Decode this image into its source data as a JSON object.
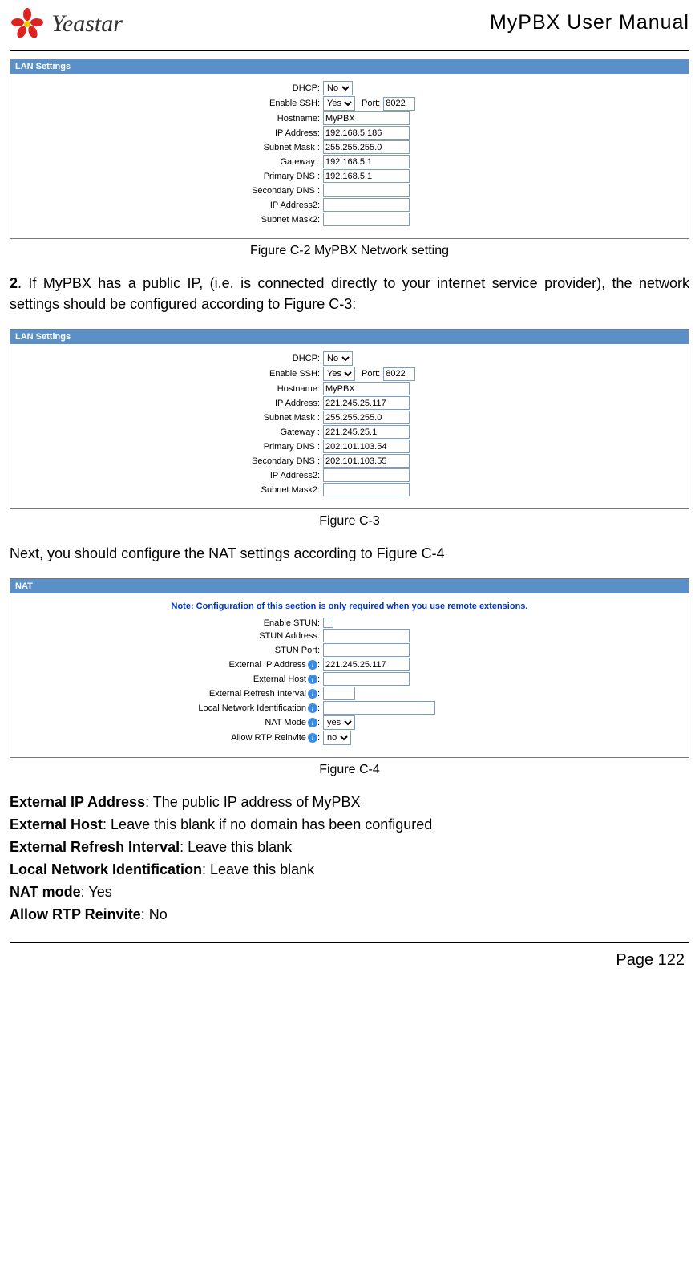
{
  "header": {
    "brand": "Yeastar",
    "doc_title": "MyPBX User Manual"
  },
  "figC2": {
    "panel_title": "LAN Settings",
    "caption": "Figure C-2 MyPBX Network setting",
    "fields": {
      "dhcp_label": "DHCP:",
      "dhcp_value": "No",
      "ssh_label": "Enable SSH:",
      "ssh_value": "Yes",
      "port_label": "Port:",
      "port_value": "8022",
      "hostname_label": "Hostname:",
      "hostname_value": "MyPBX",
      "ip_label": "IP Address:",
      "ip_value": "192.168.5.186",
      "mask_label": "Subnet Mask :",
      "mask_value": "255.255.255.0",
      "gw_label": "Gateway :",
      "gw_value": "192.168.5.1",
      "dns1_label": "Primary DNS :",
      "dns1_value": "192.168.5.1",
      "dns2_label": "Secondary DNS :",
      "dns2_value": "",
      "ip2_label": "IP Address2:",
      "ip2_value": "",
      "mask2_label": "Subnet Mask2:",
      "mask2_value": ""
    }
  },
  "para2_num": "2",
  "para2": ". If MyPBX has a public IP, (i.e. is connected directly to your internet service provider), the network settings should be configured according to Figure C-3:",
  "figC3": {
    "panel_title": "LAN Settings",
    "caption": "Figure C-3",
    "fields": {
      "dhcp_label": "DHCP:",
      "dhcp_value": "No",
      "ssh_label": "Enable SSH:",
      "ssh_value": "Yes",
      "port_label": "Port:",
      "port_value": "8022",
      "hostname_label": "Hostname:",
      "hostname_value": "MyPBX",
      "ip_label": "IP Address:",
      "ip_value": "221.245.25.117",
      "mask_label": "Subnet Mask :",
      "mask_value": "255.255.255.0",
      "gw_label": "Gateway :",
      "gw_value": "221.245.25.1",
      "dns1_label": "Primary DNS :",
      "dns1_value": "202.101.103.54",
      "dns2_label": "Secondary DNS :",
      "dns2_value": "202.101.103.55",
      "ip2_label": "IP Address2:",
      "ip2_value": "",
      "mask2_label": "Subnet Mask2:",
      "mask2_value": ""
    }
  },
  "para3": "Next, you should configure the NAT settings according to Figure C-4",
  "figC4": {
    "panel_title": "NAT",
    "caption": "Figure C-4",
    "note": "Note: Configuration of this section is only required when you use remote extensions.",
    "fields": {
      "enstun_label": "Enable STUN:",
      "stunaddr_label": "STUN Address:",
      "stunaddr_value": "",
      "stunport_label": "STUN Port:",
      "stunport_value": "",
      "extip_label": "External IP Address",
      "extip_value": "221.245.25.117",
      "exthost_label": "External Host",
      "exthost_value": "",
      "extref_label": "External Refresh Interval",
      "extref_value": "",
      "localnet_label": "Local Network Identification",
      "localnet_value": "",
      "natmode_label": "NAT Mode",
      "natmode_value": "yes",
      "allowrtp_label": "Allow RTP Reinvite",
      "allowrtp_value": "no"
    }
  },
  "definitions": {
    "d1_term": "External IP Address",
    "d1_text": ": The public IP address of MyPBX",
    "d2_term": "External Host",
    "d2_text": ": Leave this blank if no domain has been configured",
    "d3_term": "External Refresh Interval",
    "d3_text": ": Leave this blank",
    "d4_term": "Local Network Identification",
    "d4_text": ": Leave this blank",
    "d5_term": "NAT mode",
    "d5_text": ": Yes",
    "d6_term": "Allow RTP Reinvite",
    "d6_text": ": No"
  },
  "page_number": "Page 122"
}
